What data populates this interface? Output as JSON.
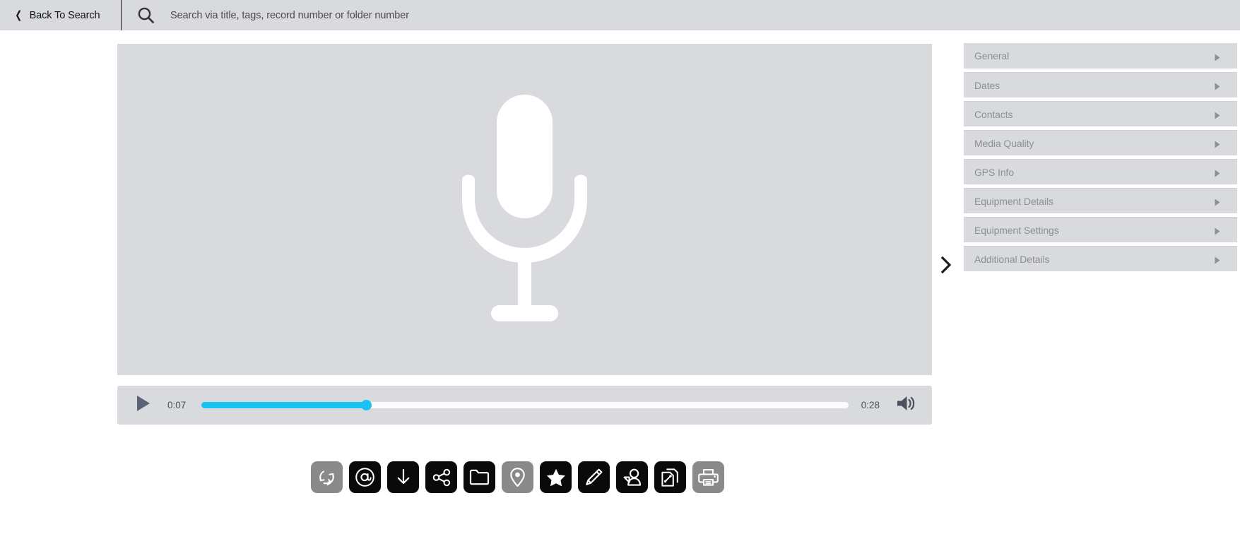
{
  "topbar": {
    "back_label": "Back To Search",
    "back_icon": "chevron-left-icon",
    "search_icon": "search-icon",
    "search_placeholder": "Search via title, tags, record number or folder number",
    "search_value": ""
  },
  "viewer": {
    "media_icon": "microphone-icon",
    "background_color": "#d9dadd"
  },
  "player": {
    "play_icon": "play-icon",
    "current_time": "0:07",
    "total_time": "0:28",
    "progress_percent": 25.5,
    "progress_color": "#18c3f3",
    "track_color": "#fcfcfc",
    "volume_icon": "volume-high-icon"
  },
  "expand": {
    "icon": "chevron-right-icon"
  },
  "accordion": {
    "arrow_icon": "triangle-right-icon",
    "items": [
      {
        "label": "General"
      },
      {
        "label": "Dates"
      },
      {
        "label": "Contacts"
      },
      {
        "label": "Media Quality"
      },
      {
        "label": "GPS Info"
      },
      {
        "label": "Equipment Details"
      },
      {
        "label": "Equipment Settings"
      },
      {
        "label": "Additional Details"
      }
    ]
  },
  "toolbar": {
    "buttons": [
      {
        "name": "refresh-rotate-icon",
        "label": "Refresh",
        "disabled": true
      },
      {
        "name": "email-at-icon",
        "label": "Email",
        "disabled": false
      },
      {
        "name": "download-arrow-icon",
        "label": "Download",
        "disabled": false
      },
      {
        "name": "share-nodes-icon",
        "label": "Share",
        "disabled": false
      },
      {
        "name": "folder-icon",
        "label": "Folder",
        "disabled": false
      },
      {
        "name": "map-pin-icon",
        "label": "Location",
        "disabled": true
      },
      {
        "name": "star-icon",
        "label": "Favorite",
        "disabled": false
      },
      {
        "name": "pencil-icon",
        "label": "Edit",
        "disabled": false
      },
      {
        "name": "person-tag-icon",
        "label": "Tag Person",
        "disabled": false
      },
      {
        "name": "copy-document-icon",
        "label": "Copy",
        "disabled": false
      },
      {
        "name": "printer-icon",
        "label": "Print",
        "disabled": true
      }
    ]
  }
}
